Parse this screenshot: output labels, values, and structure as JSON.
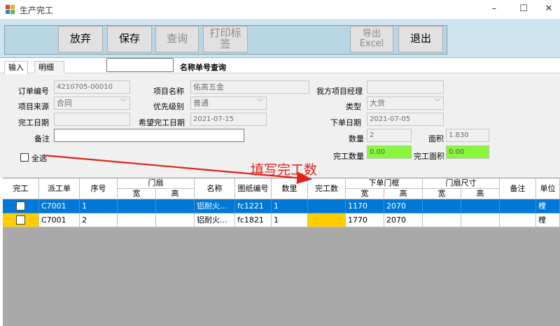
{
  "window": {
    "title": "生产完工",
    "controls": [
      "–",
      "☐",
      "✕"
    ]
  },
  "toolbar": {
    "discard": "放弃",
    "save": "保存",
    "query": "查询",
    "print_label_line1": "打印标",
    "print_label_line2": "签",
    "export_line1": "导出",
    "export_line2": "Excel",
    "exit": "退出"
  },
  "tabs": [
    "输入",
    "明细"
  ],
  "search": {
    "value": "",
    "label": "名称单号查询"
  },
  "form": {
    "order_no_label": "订单编号",
    "order_no": "4210705-00010",
    "project_name_label": "项目名称",
    "project_name": "佑高五金",
    "our_pm_label": "我方项目经理",
    "our_pm": "",
    "project_source_label": "项目来源",
    "project_source": "合同",
    "priority_label": "优先级别",
    "priority": "普通",
    "type_label": "类型",
    "type": "大货",
    "completion_date_label": "完工日期",
    "completion_date": "",
    "expected_date_label": "希望完工日期",
    "expected_date": "2021-07-15",
    "order_date_label": "下单日期",
    "order_date": "2021-07-05",
    "remark_label": "备注",
    "remark": "",
    "quantity_label": "数量",
    "quantity": "2",
    "area_label": "面积",
    "area": "1.830",
    "done_qty_label": "完工数量",
    "done_qty": "0.00",
    "done_area_label": "完工面积",
    "done_area": "0.00",
    "select_all_label": "全选"
  },
  "annotation": "填写完工数",
  "grid": {
    "headers": {
      "done": "完工",
      "dispatch": "派工单",
      "seq": "序号",
      "fan_group": "门扇",
      "fan_w": "宽",
      "fan_h": "高",
      "name": "名称",
      "drawing_no": "图纸编号",
      "qty": "数里",
      "done_count": "完工数",
      "order_frame_group": "下单门框",
      "frame_w": "宽",
      "frame_h": "高",
      "size_group": "门扇尺寸",
      "size_w": "宽",
      "size_h": "高",
      "remark": "备注",
      "unit": "单位"
    },
    "rows": [
      {
        "dispatch": "C7001",
        "seq": "1",
        "fan_w": "",
        "fan_h": "",
        "name": "铝耐火...",
        "drawing_no": "fc1221",
        "qty": "1",
        "done_count": "",
        "frame_w": "1170",
        "frame_h": "2070",
        "size_w": "",
        "size_h": "",
        "remark": "",
        "unit": "樘"
      },
      {
        "dispatch": "C7001",
        "seq": "2",
        "fan_w": "",
        "fan_h": "",
        "name": "铝耐火...",
        "drawing_no": "fc1821",
        "qty": "1",
        "done_count": "",
        "frame_w": "1770",
        "frame_h": "2070",
        "size_w": "",
        "size_h": "",
        "remark": "",
        "unit": "樘"
      }
    ]
  },
  "colors": {
    "selection": "#0078d7",
    "highlight_yellow": "#ffcc00",
    "green_field": "#88f73a",
    "annotation_red": "#e0221b"
  }
}
